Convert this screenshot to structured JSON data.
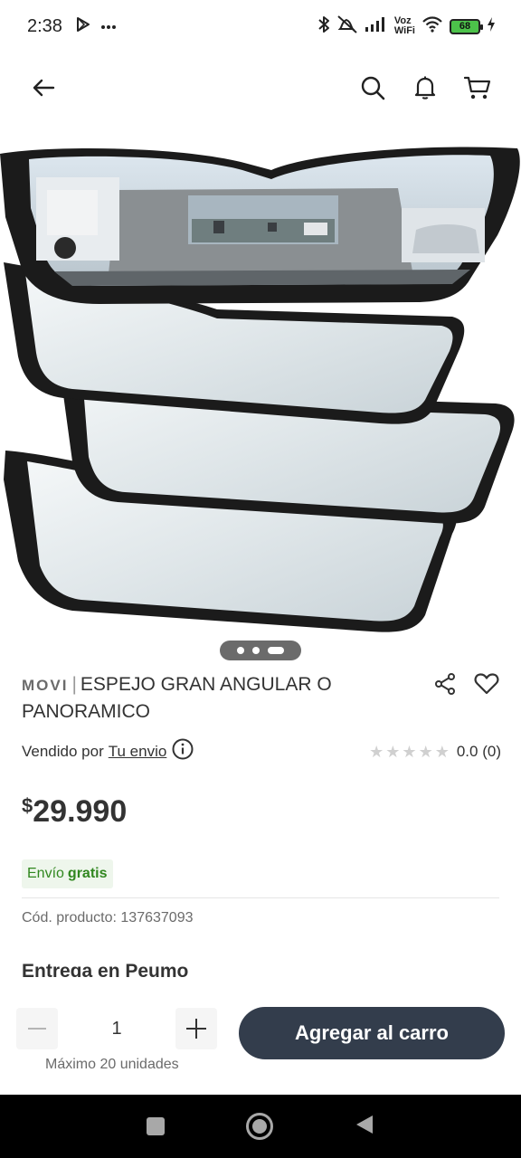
{
  "status_bar": {
    "time": "2:38",
    "voz_label": "Voz",
    "wifi_label": "WiFi",
    "battery": "68"
  },
  "product": {
    "brand": "MOVI",
    "separator": "|",
    "name": "ESPEJO GRAN ANGULAR O PANORAMICO",
    "sold_by_label": "Vendido por",
    "seller": "Tu envio",
    "rating_value": "0.0",
    "rating_count": "(0)",
    "rating_stars": 0,
    "price_currency": "$",
    "price": "29.990",
    "shipping_label": "Envío",
    "shipping_value": "gratis",
    "product_code": "Cód. producto: 137637093",
    "delivery_title": "Entrega en Peumo"
  },
  "carousel": {
    "total": 3,
    "active_index": 2
  },
  "cart": {
    "quantity": "1",
    "max_text": "Máximo 20 unidades",
    "add_label": "Agregar al carro"
  },
  "colors": {
    "button_bg": "#333d4c",
    "shipping_green": "#30871f",
    "battery_green": "#4cc24a"
  }
}
